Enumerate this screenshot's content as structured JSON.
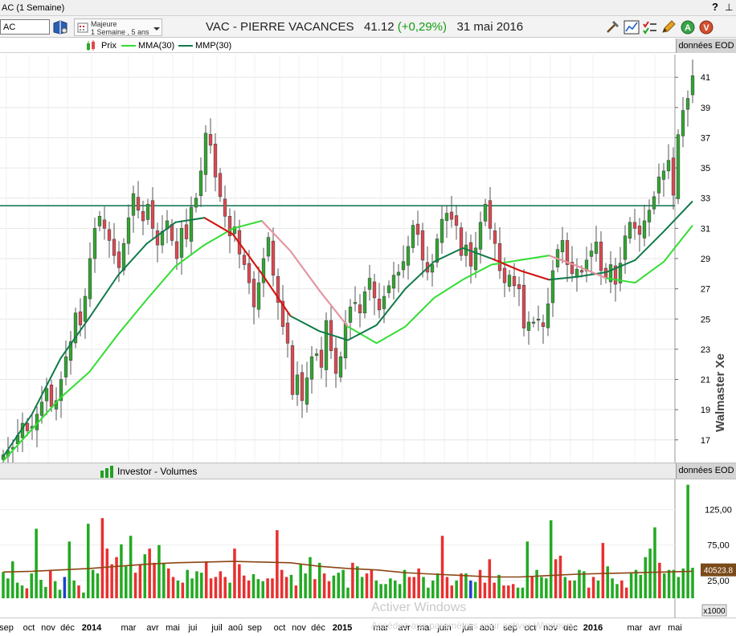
{
  "window": {
    "title": "AC (1 Semaine)",
    "help_glyph": "?",
    "pin_glyph": "⊥"
  },
  "toolbar": {
    "symbol_value": "AC",
    "period": {
      "line1": "Majeure",
      "line2": "1 Semaine , 5 ans"
    },
    "title_name": "VAC - PIERRE VACANCES",
    "title_price": "41.12",
    "title_change": "(+0,29%)",
    "title_date": "31 mai 2016",
    "icons": [
      "book-icon",
      "period-icon",
      "hammer-icon",
      "chart-icon",
      "checklist-icon",
      "pencil-icon",
      "alert-a-icon",
      "alert-v-icon"
    ]
  },
  "legend": {
    "prix": "Prix",
    "mma": "MMA(30)",
    "mmp": "MMP(30)",
    "eod": "données EOD"
  },
  "volume_legend": {
    "label": "Investor - Volumes",
    "eod": "données EOD"
  },
  "brand": "Walmaster Xe",
  "windows_watermark": {
    "line1": "Activer Windows",
    "line2": "Accédez aux paramètres pour activer Windows."
  },
  "colors": {
    "up": "#2ea82e",
    "down": "#e04850",
    "mma": "#33dd33",
    "mmp": "#117a4a",
    "mmp_down": "#e01010",
    "mmp_down_light": "#f090a8",
    "hline": "#1a7a5a",
    "vol_avg": "#8b4513"
  },
  "chart_data": [
    {
      "type": "candlestick",
      "title": "VAC - PIERRE VACANCES",
      "ylim": [
        15.5,
        42.5
      ],
      "yticks": [
        17,
        19,
        21,
        23,
        25,
        27,
        29,
        31,
        33,
        35,
        37,
        39,
        41
      ],
      "horizontal_line": 32.5,
      "series": [
        {
          "name": "MMA(30)"
        },
        {
          "name": "MMP(30)"
        }
      ],
      "price_points": [
        16.0,
        16.3,
        16.5,
        17.3,
        18.1,
        17.6,
        17.9,
        18.7,
        19.5,
        20.4,
        19.2,
        19.6,
        21.0,
        22.5,
        23.5,
        25.4,
        24.6,
        26.5,
        29.0,
        31.0,
        31.8,
        31.0,
        30.2,
        29.2,
        28.4,
        30.0,
        31.7,
        33.3,
        32.2,
        31.5,
        32.6,
        31.0,
        29.9,
        30.8,
        31.5,
        30.2,
        29.0,
        31.0,
        30.3,
        32.4,
        33.0,
        34.8,
        37.3,
        36.5,
        34.4,
        33.1,
        31.8,
        30.5,
        31.1,
        29.3,
        28.6,
        27.4,
        25.8,
        27.4,
        29.0,
        30.4,
        27.9,
        26.1,
        24.5,
        23.4,
        20.0,
        21.3,
        19.6,
        21.1,
        22.5,
        22.7,
        21.8,
        24.9,
        22.9,
        21.4,
        22.5,
        24.7,
        25.8,
        26.1,
        25.4,
        26.8,
        27.7,
        26.4,
        25.6,
        26.5,
        27.2,
        27.9,
        28.1,
        28.8,
        29.8,
        31.2,
        30.6,
        28.9,
        28.1,
        28.6,
        30.3,
        31.6,
        32.0,
        31.6,
        31.2,
        29.2,
        29.9,
        28.5,
        29.7,
        31.4,
        32.6,
        31.0,
        30.0,
        28.2,
        27.4,
        27.9,
        27.2,
        27.0,
        24.4,
        24.8,
        24.8,
        25.0,
        24.5,
        26.0,
        28.2,
        29.6,
        30.2,
        28.6,
        28.0,
        28.3,
        28.1,
        28.9,
        29.5,
        30.1,
        28.2,
        27.7,
        28.6,
        27.3,
        28.7,
        30.5,
        31.4,
        31.0,
        30.6,
        31.5,
        32.2,
        33.1,
        34.4,
        34.8,
        35.5,
        33.2,
        37.2,
        38.8,
        39.6,
        41.1
      ],
      "mma30": [
        15.6,
        17.7,
        19.8,
        21.5,
        24.0,
        26.3,
        28.5,
        29.9,
        31.0,
        31.5,
        29.5,
        26.9,
        24.5,
        23.4,
        24.5,
        26.4,
        27.6,
        28.6,
        28.9,
        29.2,
        28.5,
        27.7,
        27.4,
        28.8,
        31.2
      ],
      "mmp30": [
        15.9,
        18.7,
        22.4,
        25.1,
        27.9,
        30.0,
        31.4,
        31.7,
        30.6,
        28.0,
        25.2,
        24.2,
        23.6,
        24.6,
        27.0,
        28.8,
        29.7,
        29.0,
        28.2,
        27.6,
        27.8,
        28.1,
        28.9,
        30.8,
        32.8
      ]
    },
    {
      "type": "bar",
      "title": "Investor - Volumes",
      "unit": "x1000",
      "ylim": [
        0,
        163
      ],
      "yticks": [
        25,
        75,
        125
      ],
      "ytick_labels": [
        "25,00",
        "75,00",
        "125,00"
      ],
      "last_value_label": "40523.8",
      "volumes": [
        37,
        28,
        52,
        22,
        18,
        14,
        35,
        98,
        26,
        16,
        40,
        24,
        12,
        30,
        80,
        25,
        18,
        8,
        105,
        40,
        35,
        113,
        70,
        48,
        58,
        76,
        45,
        88,
        36,
        48,
        62,
        70,
        50,
        75,
        50,
        42,
        30,
        25,
        22,
        40,
        28,
        38,
        36,
        52,
        28,
        30,
        38,
        30,
        22,
        70,
        48,
        32,
        25,
        34,
        27,
        24,
        28,
        28,
        96,
        40,
        30,
        33,
        18,
        48,
        35,
        58,
        27,
        50,
        35,
        24,
        32,
        36,
        40,
        15,
        50,
        45,
        30,
        35,
        40,
        25,
        20,
        20,
        28,
        25,
        20,
        40,
        30,
        30,
        42,
        30,
        15,
        25,
        35,
        88,
        30,
        18,
        25,
        35,
        35,
        25,
        23,
        40,
        22,
        55,
        22,
        33,
        18,
        18,
        20,
        15,
        15,
        80,
        30,
        40,
        30,
        28,
        110,
        55,
        60,
        30,
        25,
        25,
        40,
        38,
        15,
        30,
        25,
        78,
        45,
        28,
        20,
        25,
        15,
        35,
        40,
        33,
        58,
        70,
        100,
        50,
        35,
        40,
        40,
        30,
        42,
        160,
        43
      ],
      "volume_avg": [
        37,
        38,
        40,
        42,
        45,
        48,
        50,
        51,
        52,
        51,
        50,
        45,
        42,
        40,
        36,
        34,
        32,
        30,
        30,
        32,
        34,
        35,
        36,
        37,
        38
      ]
    }
  ],
  "x_axis": {
    "labels": [
      "sep",
      "oct",
      "nov",
      "déc",
      "2014",
      "mar",
      "avr",
      "mai",
      "jui",
      "juil",
      "aoû",
      "sep",
      "oct",
      "nov",
      "déc",
      "2015",
      "mar",
      "avr",
      "mai",
      "juin",
      "juil",
      "aoû",
      "sep",
      "oct",
      "nov",
      "déc",
      "2016",
      "mar",
      "avr",
      "mai"
    ],
    "bold": [
      "2014",
      "2015",
      "2016"
    ]
  }
}
